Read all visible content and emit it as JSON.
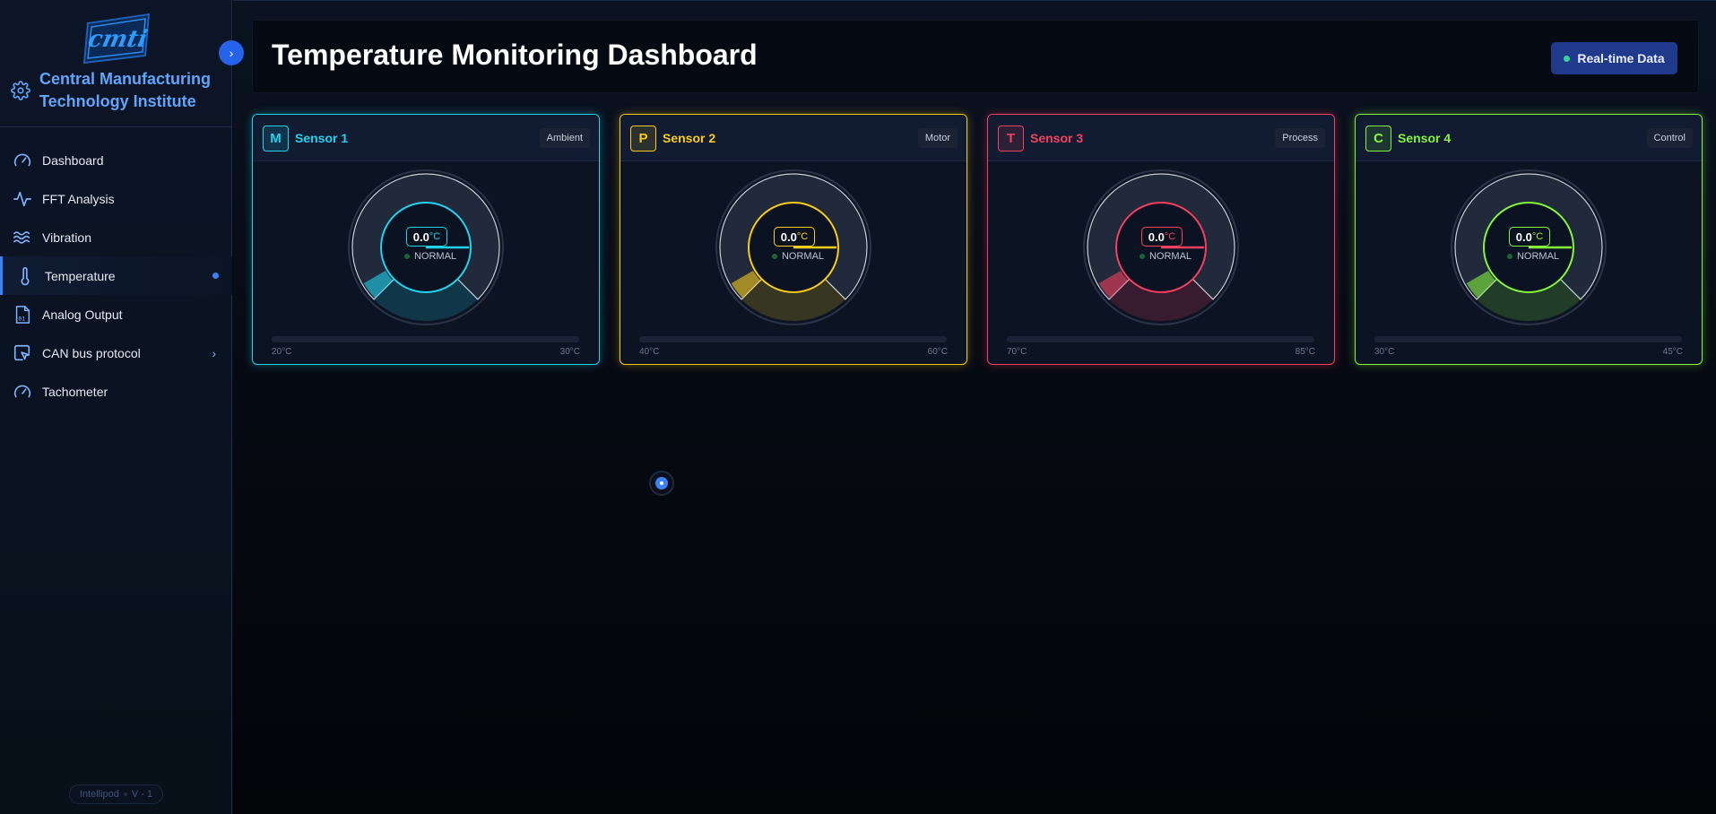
{
  "sidebar": {
    "logo_text": "cmti",
    "org_name": "Central Manufacturing\nTechnology Institute",
    "items": [
      {
        "label": "Dashboard",
        "icon": "gauge-icon"
      },
      {
        "label": "FFT Analysis",
        "icon": "activity-icon"
      },
      {
        "label": "Vibration",
        "icon": "waves-icon"
      },
      {
        "label": "Temperature",
        "icon": "thermometer-icon",
        "active": true
      },
      {
        "label": "Analog Output",
        "icon": "file-binary-icon"
      },
      {
        "label": "CAN bus protocol",
        "icon": "pointer-square-icon",
        "has_submenu": true
      },
      {
        "label": "Tachometer",
        "icon": "gauge-icon"
      }
    ],
    "version_name": "Intellipod",
    "version_num": "V - 1"
  },
  "header": {
    "title": "Temperature Monitoring Dashboard",
    "realtime_label": "Real-time Data"
  },
  "sensors": [
    {
      "letter": "M",
      "name": "Sensor 1",
      "type": "Ambient",
      "value": "0.0",
      "unit": "°C",
      "status": "NORMAL",
      "min": "20°C",
      "max": "30°C",
      "color": "#22d3ee"
    },
    {
      "letter": "P",
      "name": "Sensor 2",
      "type": "Motor",
      "value": "0.0",
      "unit": "°C",
      "status": "NORMAL",
      "min": "40°C",
      "max": "60°C",
      "color": "#facc15"
    },
    {
      "letter": "T",
      "name": "Sensor 3",
      "type": "Process",
      "value": "0.0",
      "unit": "°C",
      "status": "NORMAL",
      "min": "70°C",
      "max": "85°C",
      "color": "#f43f5e"
    },
    {
      "letter": "C",
      "name": "Sensor 4",
      "type": "Control",
      "value": "0.0",
      "unit": "°C",
      "status": "NORMAL",
      "min": "30°C",
      "max": "45°C",
      "color": "#84f53a"
    }
  ],
  "colors": {
    "accent": "#3b82f6",
    "brand_text": "#60a5fa",
    "realtime_badge": "#1f3a8a",
    "status_dot": "#34d399"
  }
}
